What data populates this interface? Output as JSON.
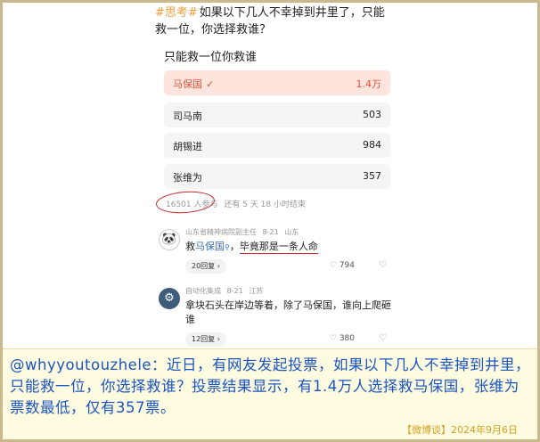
{
  "post": {
    "tag": "#思考#",
    "question": "如果以下几人不幸掉到井里了，只能救一位，你选择救谁？"
  },
  "poll": {
    "title": "只能救一位你救谁",
    "options": [
      {
        "name": "马保国",
        "count": "1.4万",
        "selected": true
      },
      {
        "name": "司马南",
        "count": "503"
      },
      {
        "name": "胡锡进",
        "count": "984"
      },
      {
        "name": "张维为",
        "count": "357"
      }
    ],
    "check_icon": "checkmark-icon",
    "participants": "16501 人参与",
    "ends_in": "还有 5 天 18 小时结束"
  },
  "comments": [
    {
      "author": "山东省精神病院副主任",
      "date": "8-21",
      "location": "山东",
      "avatar_icon": "panda-avatar",
      "prefix": "救",
      "link": "马保国",
      "comma": "，",
      "emphasis": "毕竟那是一条人命",
      "replies": "20回复 ›",
      "likes": "794"
    },
    {
      "author": "自动化集成",
      "date": "8-21",
      "location": "江苏",
      "avatar_icon": "badge-avatar",
      "text": "拿块石头在岸边等着，除了马保国，谁向上爬砸谁",
      "replies": "12回复 ›",
      "likes": "380"
    }
  ],
  "caption": {
    "text": "@whyyoutouzhele：近日，有网友发起投票，如果以下几人不幸掉到井里，只能救一位，你选择救谁？投票结果显示，有1.4万人选择救马保国，张维为票数最低，仅有357票。",
    "source": "【微博谈】2024年9月6日"
  },
  "colors": {
    "accent": "#e0533a",
    "caption_text": "#1a55c0",
    "source_text": "#d4a020",
    "annotation": "#c62828"
  }
}
